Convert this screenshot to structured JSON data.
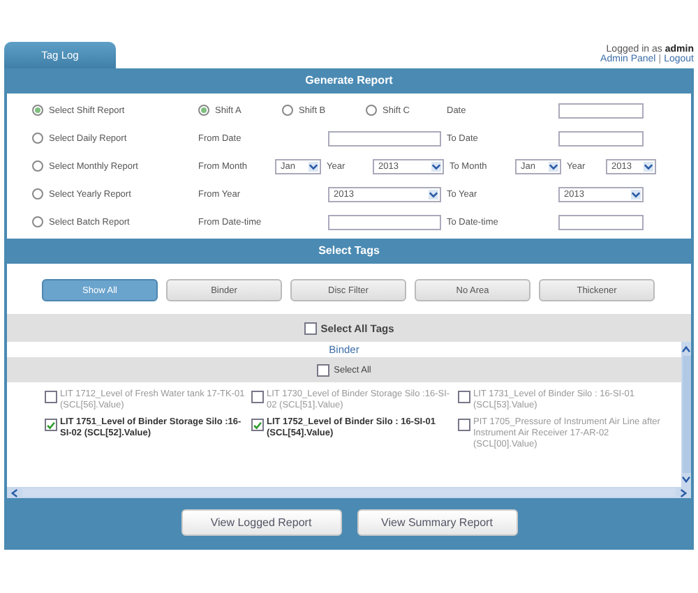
{
  "header": {
    "tab": {
      "label": "Tag Log",
      "selected": true
    },
    "login": {
      "prefix": "Logged in as",
      "user": "admin",
      "links": [
        "Admin Panel",
        "Logout"
      ],
      "separator": "|"
    }
  },
  "generate_report": {
    "title": "Generate Report",
    "rows": [
      {
        "kind": "shift",
        "label": "Select Shift Report",
        "selected": true,
        "fields": [
          {
            "kind": "radio",
            "label": "Shift A",
            "selected": true
          },
          {
            "kind": "radio",
            "label": "Shift B",
            "selected": false
          },
          {
            "kind": "radio",
            "label": "Shift C",
            "selected": false
          },
          {
            "kind": "label",
            "text": "Date"
          },
          {
            "kind": "input"
          }
        ]
      },
      {
        "kind": "daily",
        "label": "Select Daily Report",
        "selected": false,
        "fields": [
          {
            "kind": "label",
            "text": "From Date"
          },
          {
            "kind": "input"
          },
          {
            "kind": "label",
            "text": "To Date"
          },
          {
            "kind": "input"
          }
        ]
      },
      {
        "kind": "monthly",
        "label": "Select Monthly Report",
        "selected": false,
        "fields": [
          {
            "kind": "label",
            "text": "From Month"
          },
          {
            "kind": "select",
            "value": "Jan"
          },
          {
            "kind": "label",
            "text": "Year"
          },
          {
            "kind": "select",
            "value": "2013"
          },
          {
            "kind": "label",
            "text": "To Month"
          },
          {
            "kind": "select",
            "value": "Jan"
          },
          {
            "kind": "label",
            "text": "Year"
          },
          {
            "kind": "select",
            "value": "2013"
          }
        ]
      },
      {
        "kind": "yearly",
        "label": "Select Yearly Report",
        "selected": false,
        "fields": [
          {
            "kind": "label",
            "text": "From Year"
          },
          {
            "kind": "select",
            "value": "2013"
          },
          {
            "kind": "label",
            "text": "To Year"
          },
          {
            "kind": "select",
            "value": "2013"
          }
        ]
      },
      {
        "kind": "batch",
        "label": "Select Batch Report",
        "selected": false,
        "fields": [
          {
            "kind": "label",
            "text": "From Date-time"
          },
          {
            "kind": "input"
          },
          {
            "kind": "label",
            "text": "To Date-time"
          },
          {
            "kind": "input"
          }
        ]
      }
    ]
  },
  "select_tags": {
    "title": "Select Tags",
    "filters": [
      {
        "label": "Show All",
        "selected": true
      },
      {
        "label": "Binder",
        "selected": false
      },
      {
        "label": "Disc Filter",
        "selected": false
      },
      {
        "label": "No Area",
        "selected": false
      },
      {
        "label": "Thickener",
        "selected": false
      }
    ],
    "select_all_tags": {
      "label": "Select All Tags",
      "checked": false
    },
    "group": {
      "title": "Binder",
      "select_all": {
        "label": "Select All",
        "checked": false
      },
      "tags": [
        {
          "label": "LIT 1712_Level of Fresh Water tank 17-TK-01 (SCL[56].Value)",
          "checked": false
        },
        {
          "label": "LIT 1730_Level of Binder Storage Silo :16-SI-02 (SCL[51].Value)",
          "checked": false
        },
        {
          "label": "LIT 1731_Level of Binder Silo : 16-SI-01 (SCL[53].Value)",
          "checked": false
        },
        {
          "label": "LIT 1751_Level of Binder Storage Silo :16-SI-02 (SCL[52].Value)",
          "checked": true
        },
        {
          "label": "LIT 1752_Level of Binder Silo : 16-SI-01 (SCL[54].Value)",
          "checked": true
        },
        {
          "label": "PIT 1705_Pressure of Instrument Air Line after Instrument Air Receiver 17-AR-02 (SCL[00].Value)",
          "checked": false
        }
      ]
    }
  },
  "actions": [
    "View Logged Report",
    "View Summary Report"
  ]
}
